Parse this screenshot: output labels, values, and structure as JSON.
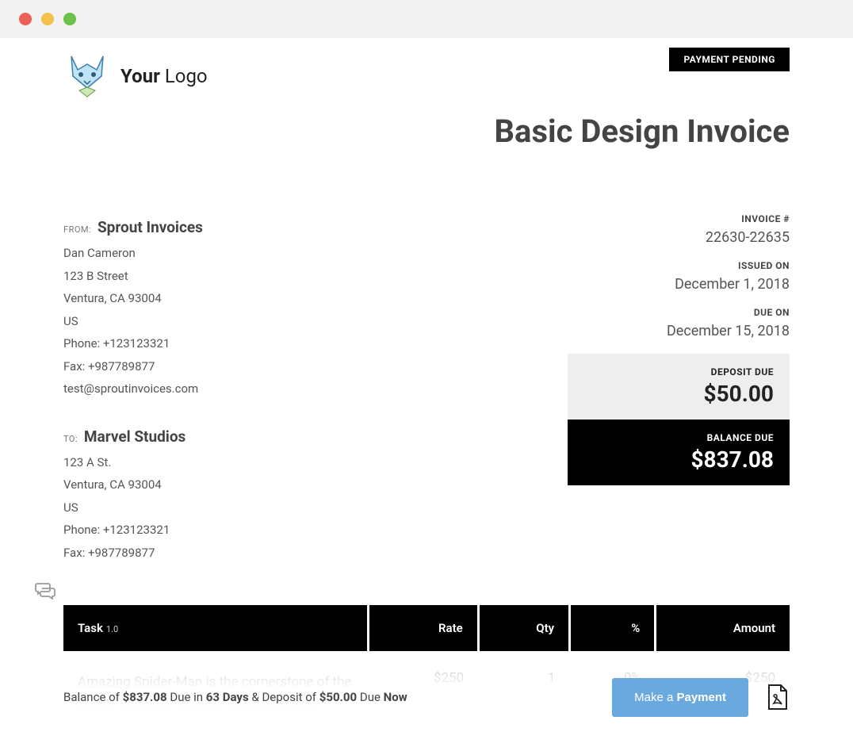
{
  "logo": {
    "text_bold": "Your",
    "text_light": " Logo"
  },
  "status_badge": "PAYMENT PENDING",
  "title": "Basic Design Invoice",
  "from": {
    "label": "FROM:",
    "name": "Sprout Invoices",
    "contact": "Dan Cameron",
    "street": "123 B Street",
    "city": "Ventura, CA 93004",
    "country": "US",
    "phone": "Phone: +123123321",
    "fax": "Fax: +987789877",
    "email": "test@sproutinvoices.com"
  },
  "to": {
    "label": "TO:",
    "name": "Marvel Studios",
    "street": "123 A St.",
    "city": "Ventura, CA 93004",
    "country": "US",
    "phone": "Phone: +123123321",
    "fax": "Fax: +987789877"
  },
  "meta": {
    "invoice_num_label": "INVOICE #",
    "invoice_num": "22630-22635",
    "issued_label": "ISSUED ON",
    "issued": "December 1, 2018",
    "due_label": "DUE ON",
    "due": "December 15, 2018"
  },
  "deposit": {
    "label": "DEPOSIT DUE",
    "amount": "$50.00"
  },
  "balance": {
    "label": "BALANCE DUE",
    "amount": "$837.08"
  },
  "table": {
    "cols": {
      "task": "Task",
      "task_ver": "1.0",
      "rate": "Rate",
      "qty": "Qty",
      "pct": "%",
      "amount": "Amount"
    },
    "row": {
      "task_link": "Amazing",
      "task_rest": " Spider-Man is the cornerstone of the Marvel Universe. But her wit, charm and intelligence just may help her survive",
      "rate": "$250",
      "qty": "1",
      "pct": "0%",
      "amount": "$250"
    }
  },
  "footer": {
    "t1": "Balance of ",
    "balance": "$837.08",
    "t2": " Due in ",
    "days": "63 Days",
    "t3": " & Deposit of ",
    "deposit": "$50.00",
    "t4": " Due ",
    "now": "Now",
    "btn_pre": "Make a ",
    "btn_bold": "Payment"
  }
}
